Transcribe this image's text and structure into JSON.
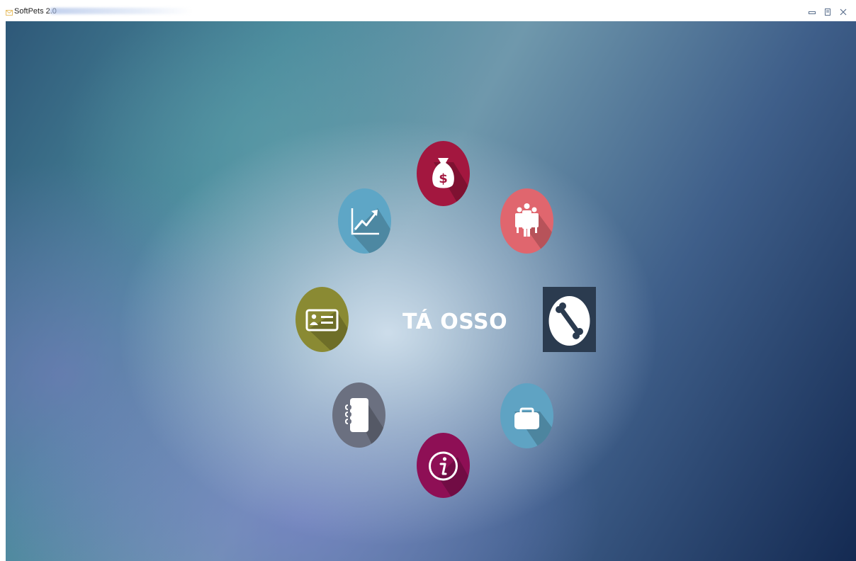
{
  "window": {
    "title": "SoftPets 2.0",
    "controls": [
      "minimize",
      "restore",
      "close"
    ]
  },
  "hub": {
    "title": "TÁ OSSO"
  },
  "menu": [
    {
      "id": "finance",
      "icon": "money-bag-icon",
      "color": "#a3173f"
    },
    {
      "id": "people",
      "icon": "people-group-icon",
      "color": "#e0666e"
    },
    {
      "id": "bone",
      "icon": "bone-icon",
      "color": "#2b3b4f"
    },
    {
      "id": "briefcase",
      "icon": "briefcase-icon",
      "color": "#5fa3c3"
    },
    {
      "id": "info",
      "icon": "info-icon",
      "color": "#8e0f55"
    },
    {
      "id": "notebook",
      "icon": "notebook-icon",
      "color": "#6b7080"
    },
    {
      "id": "id-card",
      "icon": "id-card-icon",
      "color": "#8a8a33"
    },
    {
      "id": "chart",
      "icon": "line-chart-icon",
      "color": "#5ea6c6"
    }
  ]
}
